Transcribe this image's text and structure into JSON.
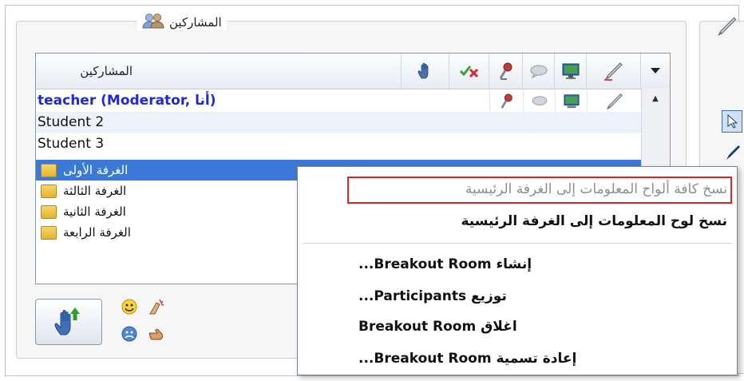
{
  "participants_panel": {
    "title": "المشاركين",
    "header_label": "المشاركين",
    "column_icons": [
      "raise-hand-icon",
      "clear-status-icon",
      "microphone-icon",
      "chat-bubble-icon",
      "monitor-icon",
      "pencil-icon"
    ],
    "rows": [
      {
        "type": "user",
        "name": "teacher (Moderator, أنا)",
        "moderator": true
      },
      {
        "type": "user",
        "name": "Student 2",
        "moderator": false
      },
      {
        "type": "user",
        "name": "Student 3",
        "moderator": false
      },
      {
        "type": "room",
        "name": "الغرفة الأولى",
        "selected": true
      },
      {
        "type": "room",
        "name": "الغرفة الثالثة",
        "selected": false
      },
      {
        "type": "room",
        "name": "الغرفة الثانية",
        "selected": false
      },
      {
        "type": "room",
        "name": "الغرفة الرابعة",
        "selected": false
      }
    ]
  },
  "context_menu": {
    "items": [
      {
        "label": "نسخ كافة ألواح المعلومات إلى الغرفة الرئيسية",
        "enabled": false,
        "highlighted": true
      },
      {
        "label": "نسخ لوح المعلومات إلى الغرفة الرئيسية",
        "enabled": true
      },
      {
        "label": "إنشاء Breakout Room...",
        "enabled": true
      },
      {
        "label": "توزيع Participants...",
        "enabled": true
      },
      {
        "label": "اغلاق Breakout Room",
        "enabled": true
      },
      {
        "label": "إعادة تسمية Breakout Room...",
        "enabled": true
      }
    ]
  },
  "colors": {
    "moderator": "#1f2ad6",
    "selection": "#3a7ad6",
    "highlight_box": "#e02424"
  }
}
